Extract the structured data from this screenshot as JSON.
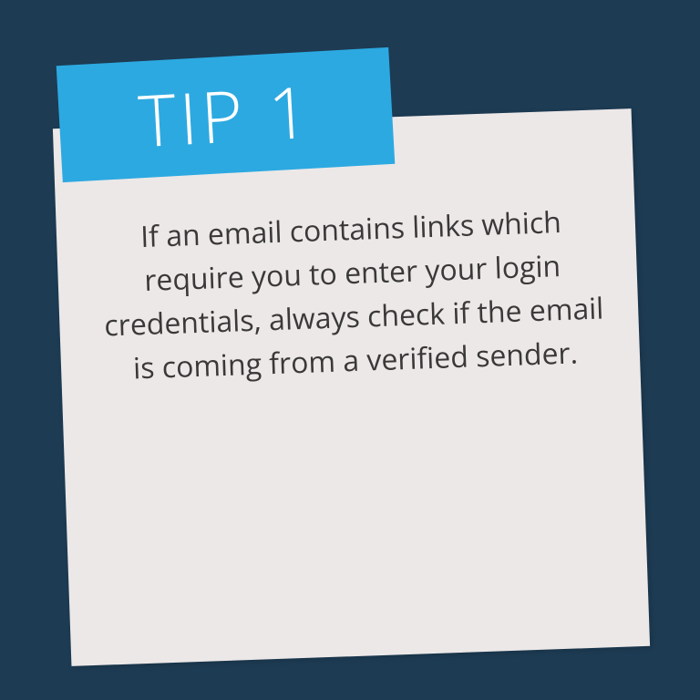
{
  "tip": {
    "badge_label": "TIP 1",
    "body_text": "If an email contains links which require you to enter your login credentials, always check if the email is coming from a verified sender."
  },
  "colors": {
    "background": "#1d3b53",
    "badge": "#2ca9e1",
    "card": "#ece8e8",
    "text": "#3a3838"
  }
}
